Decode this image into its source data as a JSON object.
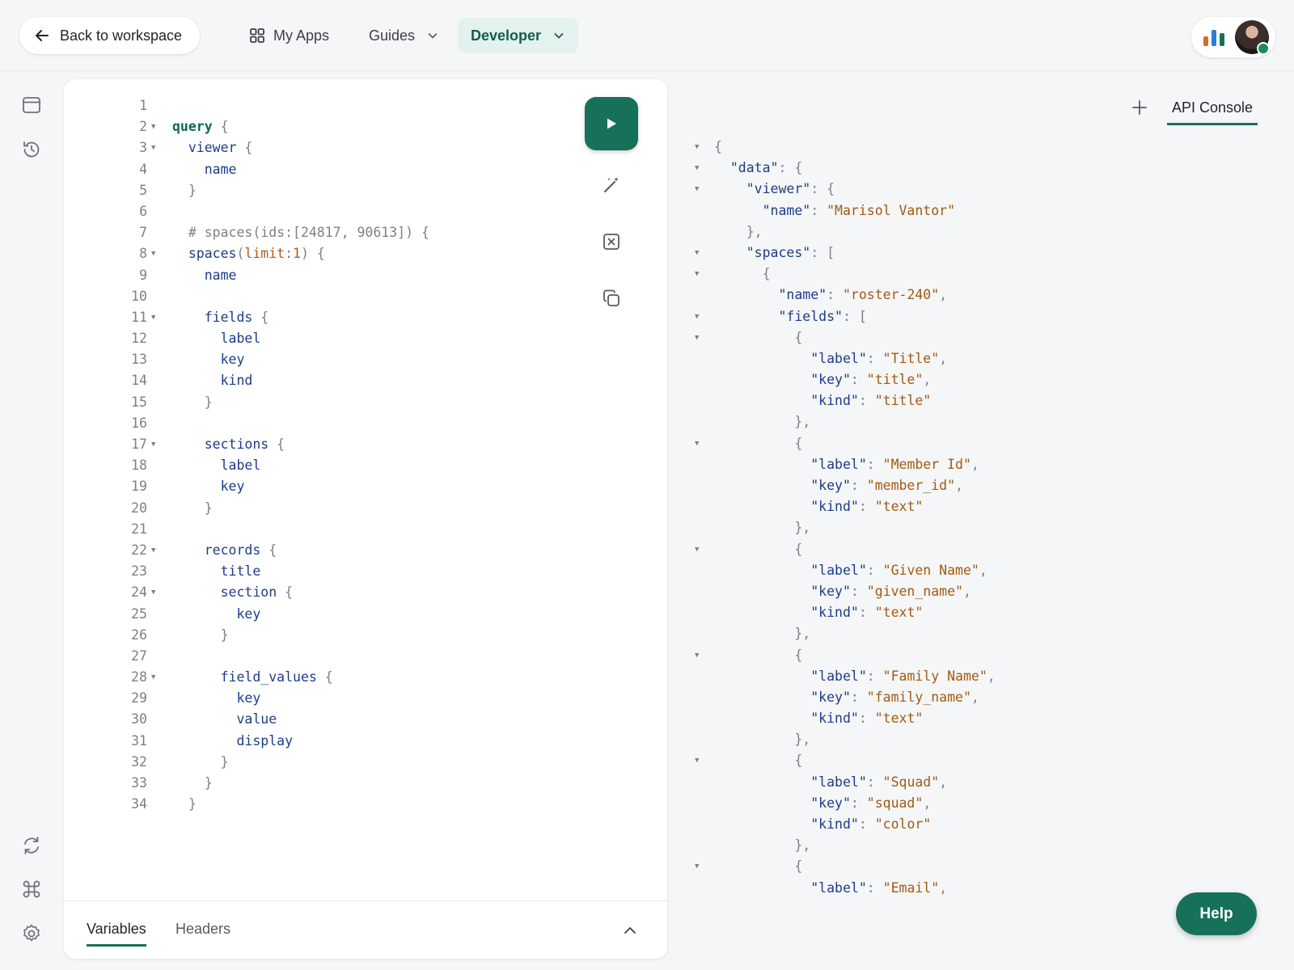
{
  "topbar": {
    "back_label": "Back to workspace",
    "myapps_label": "My Apps",
    "guides_label": "Guides",
    "developer_label": "Developer"
  },
  "colors": {
    "accent": "#17715a",
    "accent_light": "#e3f2ee",
    "code_key": "#1d3c8a",
    "code_string": "#a35a10"
  },
  "editor": {
    "lines": [
      {
        "n": "1",
        "fold": false,
        "tokens": []
      },
      {
        "n": "2",
        "fold": true,
        "tokens": [
          {
            "t": "query",
            "c": "kw"
          },
          {
            "t": " {",
            "c": "punc"
          }
        ]
      },
      {
        "n": "3",
        "fold": true,
        "tokens": [
          {
            "t": "  viewer",
            "c": ""
          },
          {
            "t": " {",
            "c": "punc"
          }
        ]
      },
      {
        "n": "4",
        "fold": false,
        "tokens": [
          {
            "t": "    name",
            "c": ""
          }
        ]
      },
      {
        "n": "5",
        "fold": false,
        "tokens": [
          {
            "t": "  }",
            "c": "punc"
          }
        ]
      },
      {
        "n": "6",
        "fold": false,
        "tokens": []
      },
      {
        "n": "7",
        "fold": false,
        "tokens": [
          {
            "t": "  # spaces(ids:[24817, 90613]) {",
            "c": "cmt"
          }
        ]
      },
      {
        "n": "8",
        "fold": true,
        "tokens": [
          {
            "t": "  spaces",
            "c": ""
          },
          {
            "t": "(",
            "c": "punc"
          },
          {
            "t": "limit",
            "c": "arg"
          },
          {
            "t": ":",
            "c": "punc"
          },
          {
            "t": "1",
            "c": "arg"
          },
          {
            "t": ") {",
            "c": "punc"
          }
        ]
      },
      {
        "n": "9",
        "fold": false,
        "tokens": [
          {
            "t": "    name",
            "c": ""
          }
        ]
      },
      {
        "n": "10",
        "fold": false,
        "tokens": []
      },
      {
        "n": "11",
        "fold": true,
        "tokens": [
          {
            "t": "    fields",
            "c": ""
          },
          {
            "t": " {",
            "c": "punc"
          }
        ]
      },
      {
        "n": "12",
        "fold": false,
        "tokens": [
          {
            "t": "      label",
            "c": ""
          }
        ]
      },
      {
        "n": "13",
        "fold": false,
        "tokens": [
          {
            "t": "      key",
            "c": ""
          }
        ]
      },
      {
        "n": "14",
        "fold": false,
        "tokens": [
          {
            "t": "      kind",
            "c": ""
          }
        ]
      },
      {
        "n": "15",
        "fold": false,
        "tokens": [
          {
            "t": "    }",
            "c": "punc"
          }
        ]
      },
      {
        "n": "16",
        "fold": false,
        "tokens": []
      },
      {
        "n": "17",
        "fold": true,
        "tokens": [
          {
            "t": "    sections",
            "c": ""
          },
          {
            "t": " {",
            "c": "punc"
          }
        ]
      },
      {
        "n": "18",
        "fold": false,
        "tokens": [
          {
            "t": "      label",
            "c": ""
          }
        ]
      },
      {
        "n": "19",
        "fold": false,
        "tokens": [
          {
            "t": "      key",
            "c": ""
          }
        ]
      },
      {
        "n": "20",
        "fold": false,
        "tokens": [
          {
            "t": "    }",
            "c": "punc"
          }
        ]
      },
      {
        "n": "21",
        "fold": false,
        "tokens": []
      },
      {
        "n": "22",
        "fold": true,
        "tokens": [
          {
            "t": "    records",
            "c": ""
          },
          {
            "t": " {",
            "c": "punc"
          }
        ]
      },
      {
        "n": "23",
        "fold": false,
        "tokens": [
          {
            "t": "      title",
            "c": ""
          }
        ]
      },
      {
        "n": "24",
        "fold": true,
        "tokens": [
          {
            "t": "      section",
            "c": ""
          },
          {
            "t": " {",
            "c": "punc"
          }
        ]
      },
      {
        "n": "25",
        "fold": false,
        "tokens": [
          {
            "t": "        key",
            "c": ""
          }
        ]
      },
      {
        "n": "26",
        "fold": false,
        "tokens": [
          {
            "t": "      }",
            "c": "punc"
          }
        ]
      },
      {
        "n": "27",
        "fold": false,
        "tokens": []
      },
      {
        "n": "28",
        "fold": true,
        "tokens": [
          {
            "t": "      field_values",
            "c": ""
          },
          {
            "t": " {",
            "c": "punc"
          }
        ]
      },
      {
        "n": "29",
        "fold": false,
        "tokens": [
          {
            "t": "        key",
            "c": ""
          }
        ]
      },
      {
        "n": "30",
        "fold": false,
        "tokens": [
          {
            "t": "        value",
            "c": ""
          }
        ]
      },
      {
        "n": "31",
        "fold": false,
        "tokens": [
          {
            "t": "        display",
            "c": ""
          }
        ]
      },
      {
        "n": "32",
        "fold": false,
        "tokens": [
          {
            "t": "      }",
            "c": "punc"
          }
        ]
      },
      {
        "n": "33",
        "fold": false,
        "tokens": [
          {
            "t": "    }",
            "c": "punc"
          }
        ]
      },
      {
        "n": "34",
        "fold": false,
        "tokens": [
          {
            "t": "  }",
            "c": "punc"
          }
        ]
      }
    ],
    "footer": {
      "variables_label": "Variables",
      "headers_label": "Headers"
    }
  },
  "result_tabs": {
    "api_console_label": "API Console"
  },
  "result": {
    "lines": [
      {
        "fold": true,
        "tokens": [
          {
            "t": "{",
            "c": ""
          }
        ]
      },
      {
        "fold": true,
        "tokens": [
          {
            "t": "  ",
            "c": ""
          },
          {
            "t": "\"data\"",
            "c": "jk"
          },
          {
            "t": ": {",
            "c": ""
          }
        ]
      },
      {
        "fold": true,
        "tokens": [
          {
            "t": "    ",
            "c": ""
          },
          {
            "t": "\"viewer\"",
            "c": "jk"
          },
          {
            "t": ": {",
            "c": ""
          }
        ]
      },
      {
        "fold": false,
        "tokens": [
          {
            "t": "      ",
            "c": ""
          },
          {
            "t": "\"name\"",
            "c": "jk"
          },
          {
            "t": ": ",
            "c": ""
          },
          {
            "t": "\"Marisol Vantor\"",
            "c": "js"
          }
        ]
      },
      {
        "fold": false,
        "tokens": [
          {
            "t": "    },",
            "c": ""
          }
        ]
      },
      {
        "fold": true,
        "tokens": [
          {
            "t": "    ",
            "c": ""
          },
          {
            "t": "\"spaces\"",
            "c": "jk"
          },
          {
            "t": ": [",
            "c": ""
          }
        ]
      },
      {
        "fold": true,
        "tokens": [
          {
            "t": "      {",
            "c": ""
          }
        ]
      },
      {
        "fold": false,
        "tokens": [
          {
            "t": "        ",
            "c": ""
          },
          {
            "t": "\"name\"",
            "c": "jk"
          },
          {
            "t": ": ",
            "c": ""
          },
          {
            "t": "\"roster-240\"",
            "c": "js"
          },
          {
            "t": ",",
            "c": ""
          }
        ]
      },
      {
        "fold": true,
        "tokens": [
          {
            "t": "        ",
            "c": ""
          },
          {
            "t": "\"fields\"",
            "c": "jk"
          },
          {
            "t": ": [",
            "c": ""
          }
        ]
      },
      {
        "fold": true,
        "tokens": [
          {
            "t": "          {",
            "c": ""
          }
        ]
      },
      {
        "fold": false,
        "tokens": [
          {
            "t": "            ",
            "c": ""
          },
          {
            "t": "\"label\"",
            "c": "jk"
          },
          {
            "t": ": ",
            "c": ""
          },
          {
            "t": "\"Title\"",
            "c": "js"
          },
          {
            "t": ",",
            "c": ""
          }
        ]
      },
      {
        "fold": false,
        "tokens": [
          {
            "t": "            ",
            "c": ""
          },
          {
            "t": "\"key\"",
            "c": "jk"
          },
          {
            "t": ": ",
            "c": ""
          },
          {
            "t": "\"title\"",
            "c": "js"
          },
          {
            "t": ",",
            "c": ""
          }
        ]
      },
      {
        "fold": false,
        "tokens": [
          {
            "t": "            ",
            "c": ""
          },
          {
            "t": "\"kind\"",
            "c": "jk"
          },
          {
            "t": ": ",
            "c": ""
          },
          {
            "t": "\"title\"",
            "c": "js"
          }
        ]
      },
      {
        "fold": false,
        "tokens": [
          {
            "t": "          },",
            "c": ""
          }
        ]
      },
      {
        "fold": true,
        "tokens": [
          {
            "t": "          {",
            "c": ""
          }
        ]
      },
      {
        "fold": false,
        "tokens": [
          {
            "t": "            ",
            "c": ""
          },
          {
            "t": "\"label\"",
            "c": "jk"
          },
          {
            "t": ": ",
            "c": ""
          },
          {
            "t": "\"Member Id\"",
            "c": "js"
          },
          {
            "t": ",",
            "c": ""
          }
        ]
      },
      {
        "fold": false,
        "tokens": [
          {
            "t": "            ",
            "c": ""
          },
          {
            "t": "\"key\"",
            "c": "jk"
          },
          {
            "t": ": ",
            "c": ""
          },
          {
            "t": "\"member_id\"",
            "c": "js"
          },
          {
            "t": ",",
            "c": ""
          }
        ]
      },
      {
        "fold": false,
        "tokens": [
          {
            "t": "            ",
            "c": ""
          },
          {
            "t": "\"kind\"",
            "c": "jk"
          },
          {
            "t": ": ",
            "c": ""
          },
          {
            "t": "\"text\"",
            "c": "js"
          }
        ]
      },
      {
        "fold": false,
        "tokens": [
          {
            "t": "          },",
            "c": ""
          }
        ]
      },
      {
        "fold": true,
        "tokens": [
          {
            "t": "          {",
            "c": ""
          }
        ]
      },
      {
        "fold": false,
        "tokens": [
          {
            "t": "            ",
            "c": ""
          },
          {
            "t": "\"label\"",
            "c": "jk"
          },
          {
            "t": ": ",
            "c": ""
          },
          {
            "t": "\"Given Name\"",
            "c": "js"
          },
          {
            "t": ",",
            "c": ""
          }
        ]
      },
      {
        "fold": false,
        "tokens": [
          {
            "t": "            ",
            "c": ""
          },
          {
            "t": "\"key\"",
            "c": "jk"
          },
          {
            "t": ": ",
            "c": ""
          },
          {
            "t": "\"given_name\"",
            "c": "js"
          },
          {
            "t": ",",
            "c": ""
          }
        ]
      },
      {
        "fold": false,
        "tokens": [
          {
            "t": "            ",
            "c": ""
          },
          {
            "t": "\"kind\"",
            "c": "jk"
          },
          {
            "t": ": ",
            "c": ""
          },
          {
            "t": "\"text\"",
            "c": "js"
          }
        ]
      },
      {
        "fold": false,
        "tokens": [
          {
            "t": "          },",
            "c": ""
          }
        ]
      },
      {
        "fold": true,
        "tokens": [
          {
            "t": "          {",
            "c": ""
          }
        ]
      },
      {
        "fold": false,
        "tokens": [
          {
            "t": "            ",
            "c": ""
          },
          {
            "t": "\"label\"",
            "c": "jk"
          },
          {
            "t": ": ",
            "c": ""
          },
          {
            "t": "\"Family Name\"",
            "c": "js"
          },
          {
            "t": ",",
            "c": ""
          }
        ]
      },
      {
        "fold": false,
        "tokens": [
          {
            "t": "            ",
            "c": ""
          },
          {
            "t": "\"key\"",
            "c": "jk"
          },
          {
            "t": ": ",
            "c": ""
          },
          {
            "t": "\"family_name\"",
            "c": "js"
          },
          {
            "t": ",",
            "c": ""
          }
        ]
      },
      {
        "fold": false,
        "tokens": [
          {
            "t": "            ",
            "c": ""
          },
          {
            "t": "\"kind\"",
            "c": "jk"
          },
          {
            "t": ": ",
            "c": ""
          },
          {
            "t": "\"text\"",
            "c": "js"
          }
        ]
      },
      {
        "fold": false,
        "tokens": [
          {
            "t": "          },",
            "c": ""
          }
        ]
      },
      {
        "fold": true,
        "tokens": [
          {
            "t": "          {",
            "c": ""
          }
        ]
      },
      {
        "fold": false,
        "tokens": [
          {
            "t": "            ",
            "c": ""
          },
          {
            "t": "\"label\"",
            "c": "jk"
          },
          {
            "t": ": ",
            "c": ""
          },
          {
            "t": "\"Squad\"",
            "c": "js"
          },
          {
            "t": ",",
            "c": ""
          }
        ]
      },
      {
        "fold": false,
        "tokens": [
          {
            "t": "            ",
            "c": ""
          },
          {
            "t": "\"key\"",
            "c": "jk"
          },
          {
            "t": ": ",
            "c": ""
          },
          {
            "t": "\"squad\"",
            "c": "js"
          },
          {
            "t": ",",
            "c": ""
          }
        ]
      },
      {
        "fold": false,
        "tokens": [
          {
            "t": "            ",
            "c": ""
          },
          {
            "t": "\"kind\"",
            "c": "jk"
          },
          {
            "t": ": ",
            "c": ""
          },
          {
            "t": "\"color\"",
            "c": "js"
          }
        ]
      },
      {
        "fold": false,
        "tokens": [
          {
            "t": "          },",
            "c": ""
          }
        ]
      },
      {
        "fold": true,
        "tokens": [
          {
            "t": "          {",
            "c": ""
          }
        ]
      },
      {
        "fold": false,
        "tokens": [
          {
            "t": "            ",
            "c": ""
          },
          {
            "t": "\"label\"",
            "c": "jk"
          },
          {
            "t": ": ",
            "c": ""
          },
          {
            "t": "\"Email\"",
            "c": "js"
          },
          {
            "t": ",",
            "c": ""
          }
        ]
      }
    ]
  },
  "help_label": "Help",
  "icons": {
    "back": "arrow-left-icon",
    "apps": "grid-icon",
    "chevron": "chevron-down-icon",
    "run": "play-icon",
    "prettify": "magic-wand-icon",
    "clear": "close-square-icon",
    "copy": "copy-icon",
    "rail": [
      "window-icon",
      "history-icon",
      "refresh-icon",
      "command-icon",
      "gear-icon"
    ]
  }
}
